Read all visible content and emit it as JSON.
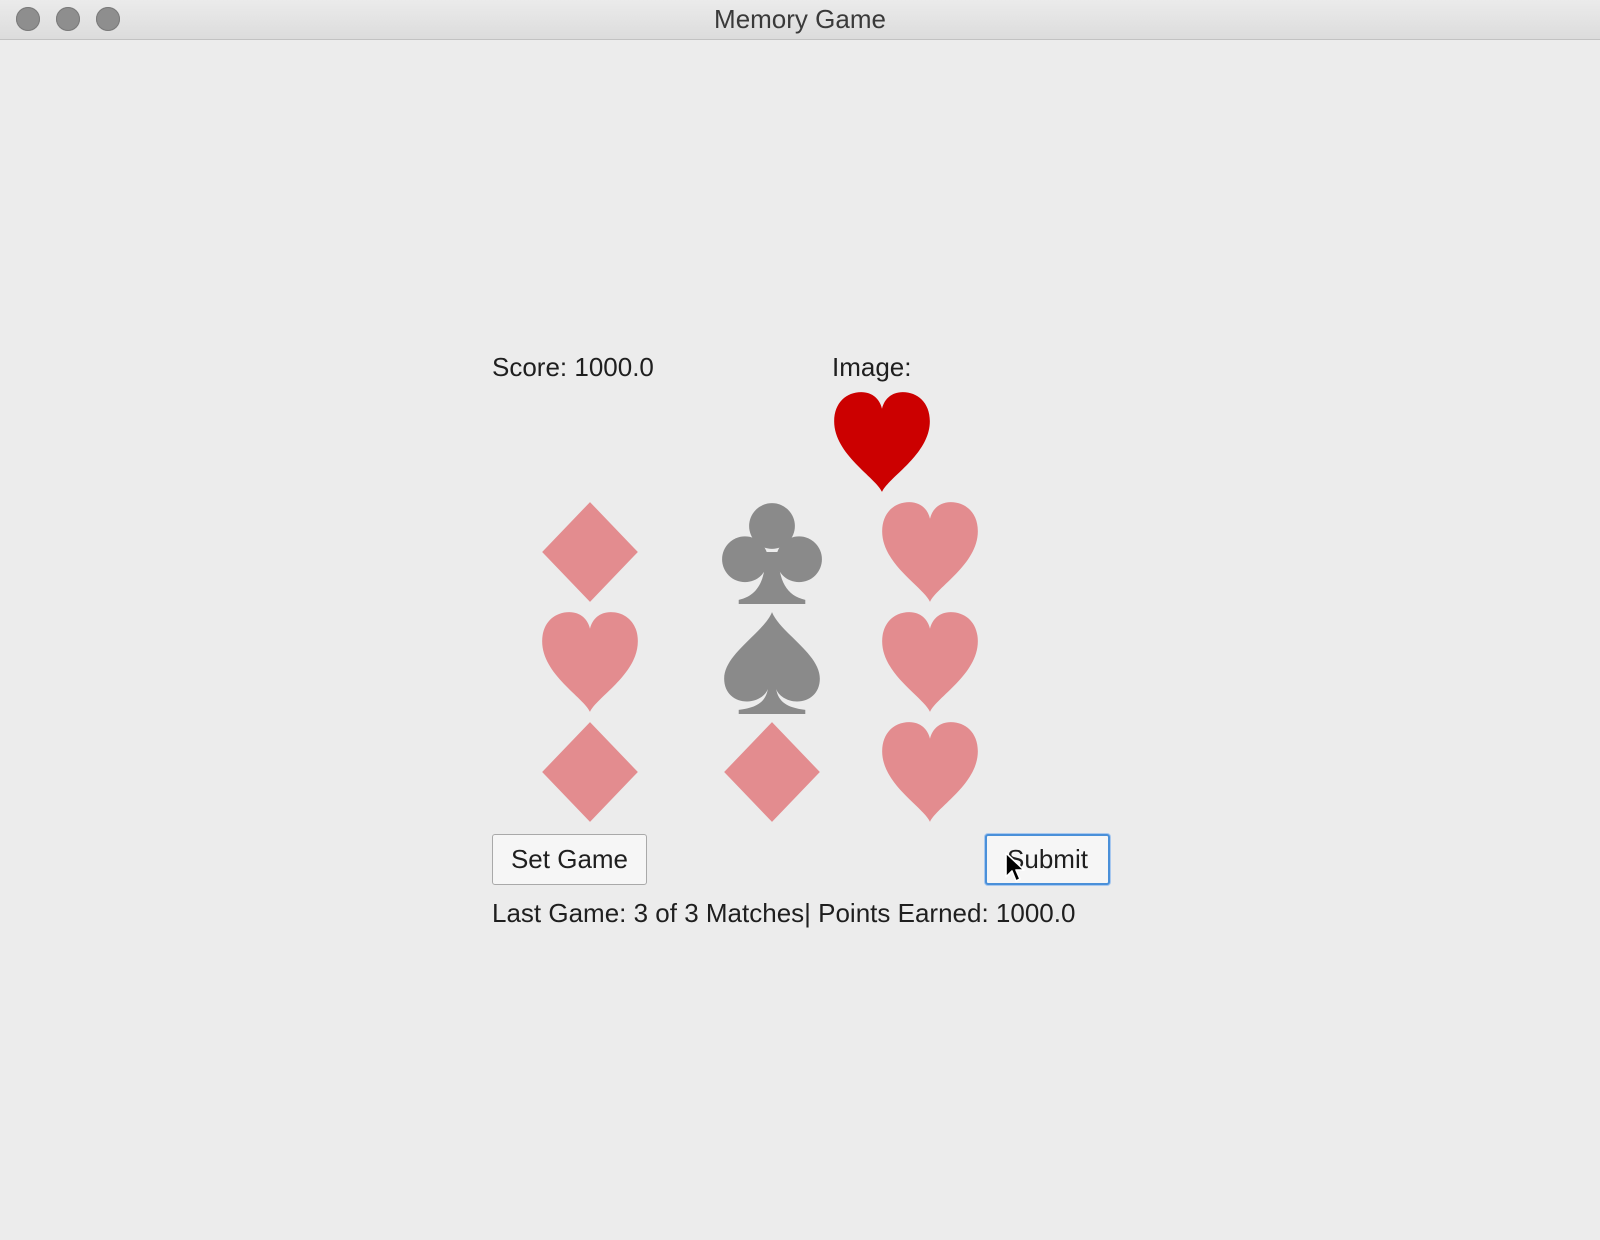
{
  "window": {
    "title": "Memory Game"
  },
  "score_label": "Score: 1000.0",
  "image_label": "Image:",
  "target_image": {
    "icon": "heart-icon",
    "color": "#cc0000"
  },
  "cards": [
    {
      "icon": "diamond-icon",
      "color": "#e38c8f"
    },
    {
      "icon": "club-icon",
      "color": "#8a8a8a"
    },
    {
      "icon": "heart-icon",
      "color": "#e38c8f"
    },
    {
      "icon": "heart-icon",
      "color": "#e38c8f"
    },
    {
      "icon": "spade-icon",
      "color": "#8a8a8a"
    },
    {
      "icon": "heart-icon",
      "color": "#e38c8f"
    },
    {
      "icon": "diamond-icon",
      "color": "#e38c8f"
    },
    {
      "icon": "diamond-icon",
      "color": "#e38c8f"
    },
    {
      "icon": "heart-icon",
      "color": "#e38c8f"
    }
  ],
  "buttons": {
    "set_game": "Set Game",
    "submit": "Submit"
  },
  "status_text": "Last Game: 3 of 3 Matches| Points Earned: 1000.0",
  "colors": {
    "focus_ring": "#4a90d9",
    "background": "#ececec"
  }
}
